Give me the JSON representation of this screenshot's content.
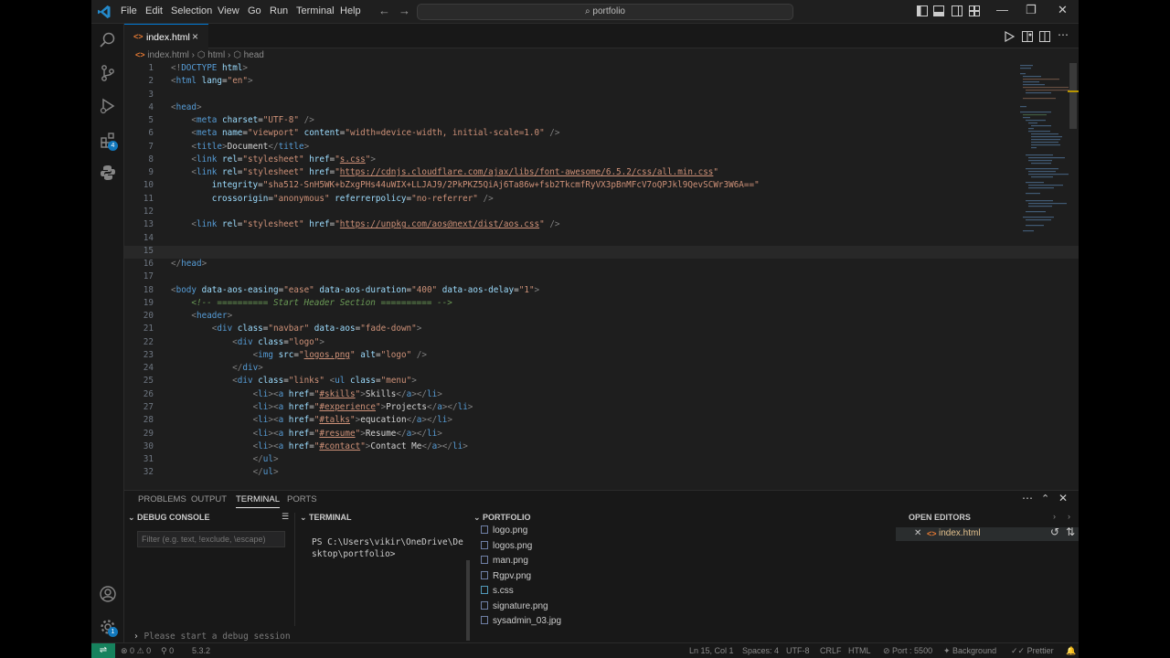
{
  "menu": [
    "File",
    "Edit",
    "Selection",
    "View",
    "Go",
    "Run",
    "Terminal",
    "Help"
  ],
  "search": {
    "text": "portfolio"
  },
  "activity": {
    "extensions_badge": "4",
    "manage_badge": "1"
  },
  "tab": {
    "label": "index.html",
    "close": "×"
  },
  "breadcrumb": {
    "file": "index.html",
    "html": "html",
    "head": "head",
    "sep": "›"
  },
  "code_lines": [
    {
      "n": 1,
      "html": "<span class=\"p\">&lt;!</span><span class=\"t\">DOCTYPE</span> <span class=\"a\">html</span><span class=\"p\">&gt;</span>"
    },
    {
      "n": 2,
      "html": "<span class=\"p\">&lt;</span><span class=\"t\">html</span> <span class=\"a\">lang</span><span class=\"x\">=</span><span class=\"s\">\"en\"</span><span class=\"p\">&gt;</span>"
    },
    {
      "n": 3,
      "html": ""
    },
    {
      "n": 4,
      "html": "<span class=\"p\">&lt;</span><span class=\"t\">head</span><span class=\"p\">&gt;</span>"
    },
    {
      "n": 5,
      "html": "    <span class=\"p\">&lt;</span><span class=\"t\">meta</span> <span class=\"a\">charset</span><span class=\"x\">=</span><span class=\"s\">\"UTF-8\"</span> <span class=\"p\">/&gt;</span>"
    },
    {
      "n": 6,
      "html": "    <span class=\"p\">&lt;</span><span class=\"t\">meta</span> <span class=\"a\">name</span><span class=\"x\">=</span><span class=\"s\">\"viewport\"</span> <span class=\"a\">content</span><span class=\"x\">=</span><span class=\"s\">\"width=device-width, initial-scale=1.0\"</span> <span class=\"p\">/&gt;</span>"
    },
    {
      "n": 7,
      "html": "    <span class=\"p\">&lt;</span><span class=\"t\">title</span><span class=\"p\">&gt;</span><span class=\"x\">Document</span><span class=\"p\">&lt;/</span><span class=\"t\">title</span><span class=\"p\">&gt;</span>"
    },
    {
      "n": 8,
      "html": "    <span class=\"p\">&lt;</span><span class=\"t\">link</span> <span class=\"a\">rel</span><span class=\"x\">=</span><span class=\"s\">\"stylesheet\"</span> <span class=\"a\">href</span><span class=\"x\">=</span><span class=\"s\">\"</span><span class=\"u\">s.css</span><span class=\"s\">\"</span><span class=\"p\">&gt;</span>"
    },
    {
      "n": 9,
      "html": "    <span class=\"p\">&lt;</span><span class=\"t\">link</span> <span class=\"a\">rel</span><span class=\"x\">=</span><span class=\"s\">\"stylesheet\"</span> <span class=\"a\">href</span><span class=\"x\">=</span><span class=\"s\">\"</span><span class=\"u\">https://cdnjs.cloudflare.com/ajax/libs/font-awesome/6.5.2/css/all.min.css</span><span class=\"s\">\"</span>"
    },
    {
      "n": 10,
      "html": "        <span class=\"a\">integrity</span><span class=\"x\">=</span><span class=\"s\">\"sha512-SnH5WK+bZxgPHs44uWIX+LLJAJ9/2PkPKZ5QiAj6Ta86w+fsb2TkcmfRyVX3pBnMFcV7oQPJkl9QevSCWr3W6A==\"</span>"
    },
    {
      "n": 11,
      "html": "        <span class=\"a\">crossorigin</span><span class=\"x\">=</span><span class=\"s\">\"anonymous\"</span> <span class=\"a\">referrerpolicy</span><span class=\"x\">=</span><span class=\"s\">\"no-referrer\"</span> <span class=\"p\">/&gt;</span>"
    },
    {
      "n": 12,
      "html": ""
    },
    {
      "n": 13,
      "html": "    <span class=\"p\">&lt;</span><span class=\"t\">link</span> <span class=\"a\">rel</span><span class=\"x\">=</span><span class=\"s\">\"stylesheet\"</span> <span class=\"a\">href</span><span class=\"x\">=</span><span class=\"s\">\"</span><span class=\"u\">https://unpkg.com/aos@next/dist/aos.css</span><span class=\"s\">\"</span> <span class=\"p\">/&gt;</span>"
    },
    {
      "n": 14,
      "html": ""
    },
    {
      "n": 15,
      "html": ""
    },
    {
      "n": 16,
      "html": "<span class=\"p\">&lt;/</span><span class=\"t\">head</span><span class=\"p\">&gt;</span>"
    },
    {
      "n": 17,
      "html": ""
    },
    {
      "n": 18,
      "html": "<span class=\"p\">&lt;</span><span class=\"t\">body</span> <span class=\"a\">data-aos-easing</span><span class=\"x\">=</span><span class=\"s\">\"ease\"</span> <span class=\"a\">data-aos-duration</span><span class=\"x\">=</span><span class=\"s\">\"400\"</span> <span class=\"a\">data-aos-delay</span><span class=\"x\">=</span><span class=\"s\">\"1\"</span><span class=\"p\">&gt;</span>"
    },
    {
      "n": 19,
      "html": "    <span class=\"c\">&lt;!-- ========== Start Header Section ========== --&gt;</span>"
    },
    {
      "n": 20,
      "html": "    <span class=\"p\">&lt;</span><span class=\"t\">header</span><span class=\"p\">&gt;</span>"
    },
    {
      "n": 21,
      "html": "        <span class=\"p\">&lt;</span><span class=\"t\">div</span> <span class=\"a\">class</span><span class=\"x\">=</span><span class=\"s\">\"navbar\"</span> <span class=\"a\">data-aos</span><span class=\"x\">=</span><span class=\"s\">\"fade-down\"</span><span class=\"p\">&gt;</span>"
    },
    {
      "n": 22,
      "html": "            <span class=\"p\">&lt;</span><span class=\"t\">div</span> <span class=\"a\">class</span><span class=\"x\">=</span><span class=\"s\">\"logo\"</span><span class=\"p\">&gt;</span>"
    },
    {
      "n": 23,
      "html": "                <span class=\"p\">&lt;</span><span class=\"t\">img</span> <span class=\"a\">src</span><span class=\"x\">=</span><span class=\"s\">\"</span><span class=\"u\">logos.png</span><span class=\"s\">\"</span> <span class=\"a\">alt</span><span class=\"x\">=</span><span class=\"s\">\"logo\"</span> <span class=\"p\">/&gt;</span>"
    },
    {
      "n": 24,
      "html": "            <span class=\"p\">&lt;/</span><span class=\"t\">div</span><span class=\"p\">&gt;</span>"
    },
    {
      "n": 25,
      "html": "            <span class=\"p\">&lt;</span><span class=\"t\">div</span> <span class=\"a\">class</span><span class=\"x\">=</span><span class=\"s\">\"links\"</span> <span class=\"p\">&lt;</span><span class=\"t\">ul</span> <span class=\"a\">class</span><span class=\"x\">=</span><span class=\"s\">\"menu\"</span><span class=\"p\">&gt;</span>"
    },
    {
      "n": 26,
      "html": "                <span class=\"p\">&lt;</span><span class=\"t\">li</span><span class=\"p\">&gt;&lt;</span><span class=\"t\">a</span> <span class=\"a\">href</span><span class=\"x\">=</span><span class=\"s\">\"</span><span class=\"u\">#skills</span><span class=\"s\">\"</span><span class=\"p\">&gt;</span><span class=\"x\">Skills</span><span class=\"p\">&lt;/</span><span class=\"t\">a</span><span class=\"p\">&gt;&lt;/</span><span class=\"t\">li</span><span class=\"p\">&gt;</span>"
    },
    {
      "n": 27,
      "html": "                <span class=\"p\">&lt;</span><span class=\"t\">li</span><span class=\"p\">&gt;&lt;</span><span class=\"t\">a</span> <span class=\"a\">href</span><span class=\"x\">=</span><span class=\"s\">\"</span><span class=\"u\">#experience</span><span class=\"s\">\"</span><span class=\"p\">&gt;</span><span class=\"x\">Projects</span><span class=\"p\">&lt;/</span><span class=\"t\">a</span><span class=\"p\">&gt;&lt;/</span><span class=\"t\">li</span><span class=\"p\">&gt;</span>"
    },
    {
      "n": 28,
      "html": "                <span class=\"p\">&lt;</span><span class=\"t\">li</span><span class=\"p\">&gt;&lt;</span><span class=\"t\">a</span> <span class=\"a\">href</span><span class=\"x\">=</span><span class=\"s\">\"</span><span class=\"u\">#talks</span><span class=\"s\">\"</span><span class=\"p\">&gt;</span><span class=\"x\">equcation</span><span class=\"p\">&lt;/</span><span class=\"t\">a</span><span class=\"p\">&gt;&lt;/</span><span class=\"t\">li</span><span class=\"p\">&gt;</span>"
    },
    {
      "n": 29,
      "html": "                <span class=\"p\">&lt;</span><span class=\"t\">li</span><span class=\"p\">&gt;&lt;</span><span class=\"t\">a</span> <span class=\"a\">href</span><span class=\"x\">=</span><span class=\"s\">\"</span><span class=\"u\">#resume</span><span class=\"s\">\"</span><span class=\"p\">&gt;</span><span class=\"x\">Resume</span><span class=\"p\">&lt;/</span><span class=\"t\">a</span><span class=\"p\">&gt;&lt;/</span><span class=\"t\">li</span><span class=\"p\">&gt;</span>"
    },
    {
      "n": 30,
      "html": "                <span class=\"p\">&lt;</span><span class=\"t\">li</span><span class=\"p\">&gt;&lt;</span><span class=\"t\">a</span> <span class=\"a\">href</span><span class=\"x\">=</span><span class=\"s\">\"</span><span class=\"u\">#contact</span><span class=\"s\">\"</span><span class=\"p\">&gt;</span><span class=\"x\">Contact Me</span><span class=\"p\">&lt;/</span><span class=\"t\">a</span><span class=\"p\">&gt;&lt;/</span><span class=\"t\">li</span><span class=\"p\">&gt;</span>"
    },
    {
      "n": 31,
      "html": "                <span class=\"p\">&lt;/</span><span class=\"t\">ul</span><span class=\"p\">&gt;</span>"
    },
    {
      "n": 32,
      "html": "                <span class=\"p\">&lt;/</span><span class=\"t\">ul</span><span class=\"p\">&gt;</span>"
    }
  ],
  "panel": {
    "tabs": [
      "PROBLEMS",
      "OUTPUT",
      "TERMINAL",
      "PORTS"
    ],
    "debug_console": "DEBUG CONSOLE",
    "terminal": "TERMINAL",
    "portfolio": "PORTFOLIO",
    "open_editors": "OPEN EDITORS",
    "filter_placeholder": "Filter (e.g. text, !exclude, \\escape)",
    "terminal_text": "PS C:\\Users\\vikir\\OneDrive\\Desktop\\portfolio>",
    "files": [
      "logo.png",
      "logos.png",
      "man.png",
      "Rgpv.png",
      "s.css",
      "signature.png",
      "sysadmin_03.jpg"
    ],
    "open_editor_file": "index.html",
    "debug_prompt": "Please start a debug session"
  },
  "status": {
    "errors": "0",
    "warnings": "0",
    "ports": "0",
    "version": "5.3.2",
    "position": "Ln 15, Col 1",
    "spaces": "Spaces: 4",
    "encoding": "UTF-8",
    "eol": "CRLF",
    "language": "HTML",
    "port": "Port : 5500",
    "background": "Background",
    "prettier": "Prettier"
  },
  "colors": {
    "accent": "#0078d4",
    "remote": "#16825d",
    "badge": "#1177bb"
  }
}
